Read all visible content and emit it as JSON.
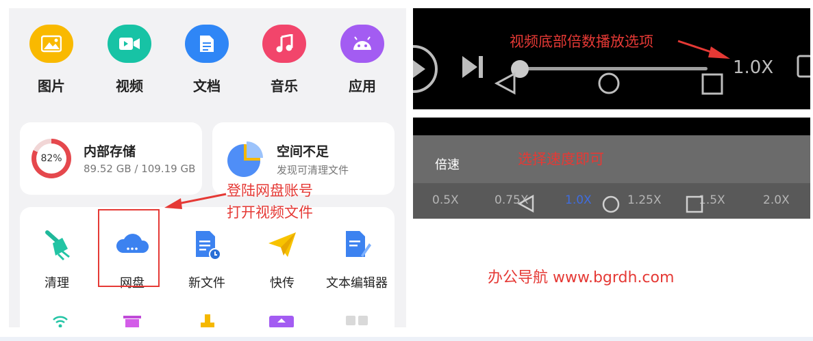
{
  "file_manager": {
    "categories": [
      {
        "label": "图片",
        "icon": "image-icon",
        "color": "#f9b900"
      },
      {
        "label": "视频",
        "icon": "video-icon",
        "color": "#17c3a5"
      },
      {
        "label": "文档",
        "icon": "document-icon",
        "color": "#2f86f6"
      },
      {
        "label": "音乐",
        "icon": "music-icon",
        "color": "#f2456b"
      },
      {
        "label": "应用",
        "icon": "android-icon",
        "color": "#a35cf2"
      }
    ],
    "internal_storage": {
      "title": "内部存储",
      "percent_text": "82%",
      "percent": 82,
      "detail": "89.52 GB / 109.19 GB"
    },
    "space_warning": {
      "title": "空间不足",
      "detail": "发现可清理文件"
    },
    "tools": [
      {
        "label": "清理",
        "icon": "broom-icon"
      },
      {
        "label": "网盘",
        "icon": "cloud-drive-icon"
      },
      {
        "label": "新文件",
        "icon": "new-file-icon"
      },
      {
        "label": "快传",
        "icon": "paper-plane-icon"
      },
      {
        "label": "文本编辑器",
        "icon": "text-editor-icon"
      }
    ],
    "annotation_lines": [
      "登陆网盘账号",
      "打开视频文件"
    ]
  },
  "player": {
    "annotation": "视频底部倍数播放选项",
    "speed": "1.0X",
    "seek_fraction": 0.0
  },
  "speed_menu": {
    "title": "倍速",
    "annotation": "选择速度即可",
    "options": [
      "0.5X",
      "0.75X",
      "1.0X",
      "1.25X",
      "1.5X",
      "2.0X"
    ],
    "selected": "1.0X"
  },
  "watermark": "办公导航 www.bgrdh.com",
  "colors": {
    "annotation_red": "#e53935",
    "selected_blue": "#3f6de0"
  }
}
